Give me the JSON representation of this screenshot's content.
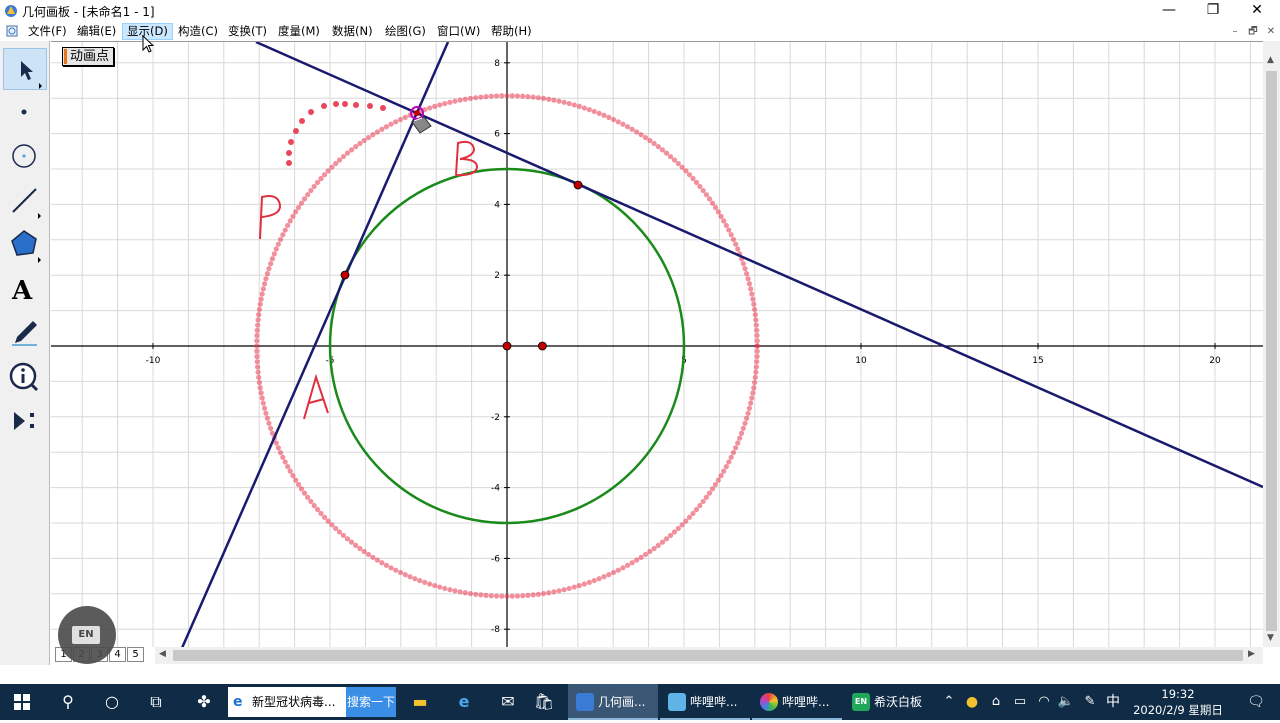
{
  "window": {
    "title": "几何画板 - [未命名1 - 1]",
    "controls": {
      "minimize": "—",
      "restore": "❐",
      "close": "✕"
    }
  },
  "menubar": {
    "items": [
      "文件(F)",
      "编辑(E)",
      "显示(D)",
      "构造(C)",
      "变换(T)",
      "度量(M)",
      "数据(N)",
      "绘图(G)",
      "窗口(W)",
      "帮助(H)"
    ],
    "active_item": "显示(D)",
    "mdi_controls": {
      "minimize": "–",
      "restore": "🗗",
      "close": "✕"
    }
  },
  "toolbox": {
    "tools": [
      "selection-arrow-tool",
      "point-tool",
      "compass-tool",
      "straightedge-tool",
      "polygon-tool",
      "text-tool",
      "marker-tool",
      "information-tool",
      "custom-tools"
    ],
    "active_tool": "selection-arrow-tool",
    "text_tool_glyph": "A"
  },
  "canvas": {
    "animation_button": "动画点",
    "x_axis_ticks": [
      "-10",
      "-5",
      "5",
      "10",
      "15",
      "20"
    ],
    "y_axis_ticks": [
      "8",
      "6",
      "4",
      "2",
      "-2",
      "-4",
      "-6",
      "-8"
    ],
    "handwritten_labels": [
      "P",
      "B",
      "A"
    ],
    "colors": {
      "grid": "#d8d8d8",
      "axis": "#000000",
      "green_circle": "#1a8a1a",
      "lines": "#1a1a6e",
      "trace": "#e8334a",
      "points": "#c00000",
      "animated_point": "#c000c0"
    }
  },
  "page_tabs": [
    "1",
    "2",
    "3",
    "4",
    "5"
  ],
  "floating_ime": {
    "label": "EN"
  },
  "taskbar": {
    "search_text": "新型冠状病毒...",
    "search_button": "搜索一下",
    "apps": [
      {
        "label": "几何画...",
        "active": true
      },
      {
        "label": "哔哩哔...",
        "active": false
      },
      {
        "label": "哔哩哔...",
        "active": false
      },
      {
        "label": "希沃白板",
        "active": false
      }
    ],
    "tray": {
      "ime": "中"
    },
    "clock": {
      "time": "19:32",
      "date": "2020/2/9 星期日"
    }
  }
}
